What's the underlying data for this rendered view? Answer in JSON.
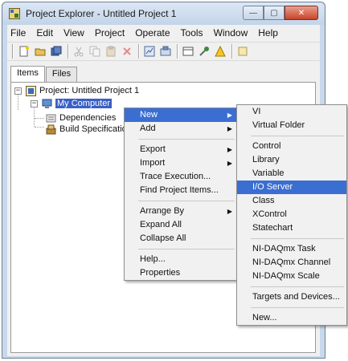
{
  "window": {
    "title": "Project Explorer - Untitled Project 1",
    "caption_buttons": {
      "minimize": "—",
      "maximize": "▢",
      "close": "✕"
    }
  },
  "menubar": [
    "File",
    "Edit",
    "View",
    "Project",
    "Operate",
    "Tools",
    "Window",
    "Help"
  ],
  "toolbar": {
    "icons": [
      "new-icon",
      "open-icon",
      "save-all-icon",
      "cut-icon",
      "copy-icon",
      "paste-icon",
      "delete-icon",
      "vi-settings-icon",
      "build-icon",
      "view-icon",
      "tools-icon",
      "warning-icon",
      "properties-icon"
    ]
  },
  "tabs": [
    {
      "label": "Items",
      "active": true
    },
    {
      "label": "Files",
      "active": false
    }
  ],
  "tree": {
    "project": "Project: Untitled Project 1",
    "my_computer": "My Computer",
    "dependencies": "Dependencies",
    "build_specs": "Build Specifications"
  },
  "context_menu": {
    "items": [
      {
        "label": "New",
        "submenu": true,
        "highlighted": true
      },
      {
        "label": "Add",
        "submenu": true
      },
      {
        "separator": true
      },
      {
        "label": "Export",
        "submenu": true
      },
      {
        "label": "Import",
        "submenu": true
      },
      {
        "label": "Trace Execution..."
      },
      {
        "label": "Find Project Items..."
      },
      {
        "separator": true
      },
      {
        "label": "Arrange By",
        "submenu": true
      },
      {
        "label": "Expand All"
      },
      {
        "label": "Collapse All"
      },
      {
        "separator": true
      },
      {
        "label": "Help..."
      },
      {
        "label": "Properties"
      }
    ]
  },
  "submenu_new": {
    "items": [
      {
        "label": "VI"
      },
      {
        "label": "Virtual Folder"
      },
      {
        "separator": true
      },
      {
        "label": "Control"
      },
      {
        "label": "Library"
      },
      {
        "label": "Variable"
      },
      {
        "label": "I/O Server",
        "highlighted": true
      },
      {
        "label": "Class"
      },
      {
        "label": "XControl"
      },
      {
        "label": "Statechart"
      },
      {
        "separator": true
      },
      {
        "label": "NI-DAQmx Task"
      },
      {
        "label": "NI-DAQmx Channel"
      },
      {
        "label": "NI-DAQmx Scale"
      },
      {
        "separator": true
      },
      {
        "label": "Targets and Devices..."
      },
      {
        "separator": true
      },
      {
        "label": "New..."
      }
    ]
  },
  "colors": {
    "selection": "#3b6ed1",
    "tree_selection": "#3a60c4",
    "window_frame": "#c9d8ea"
  }
}
